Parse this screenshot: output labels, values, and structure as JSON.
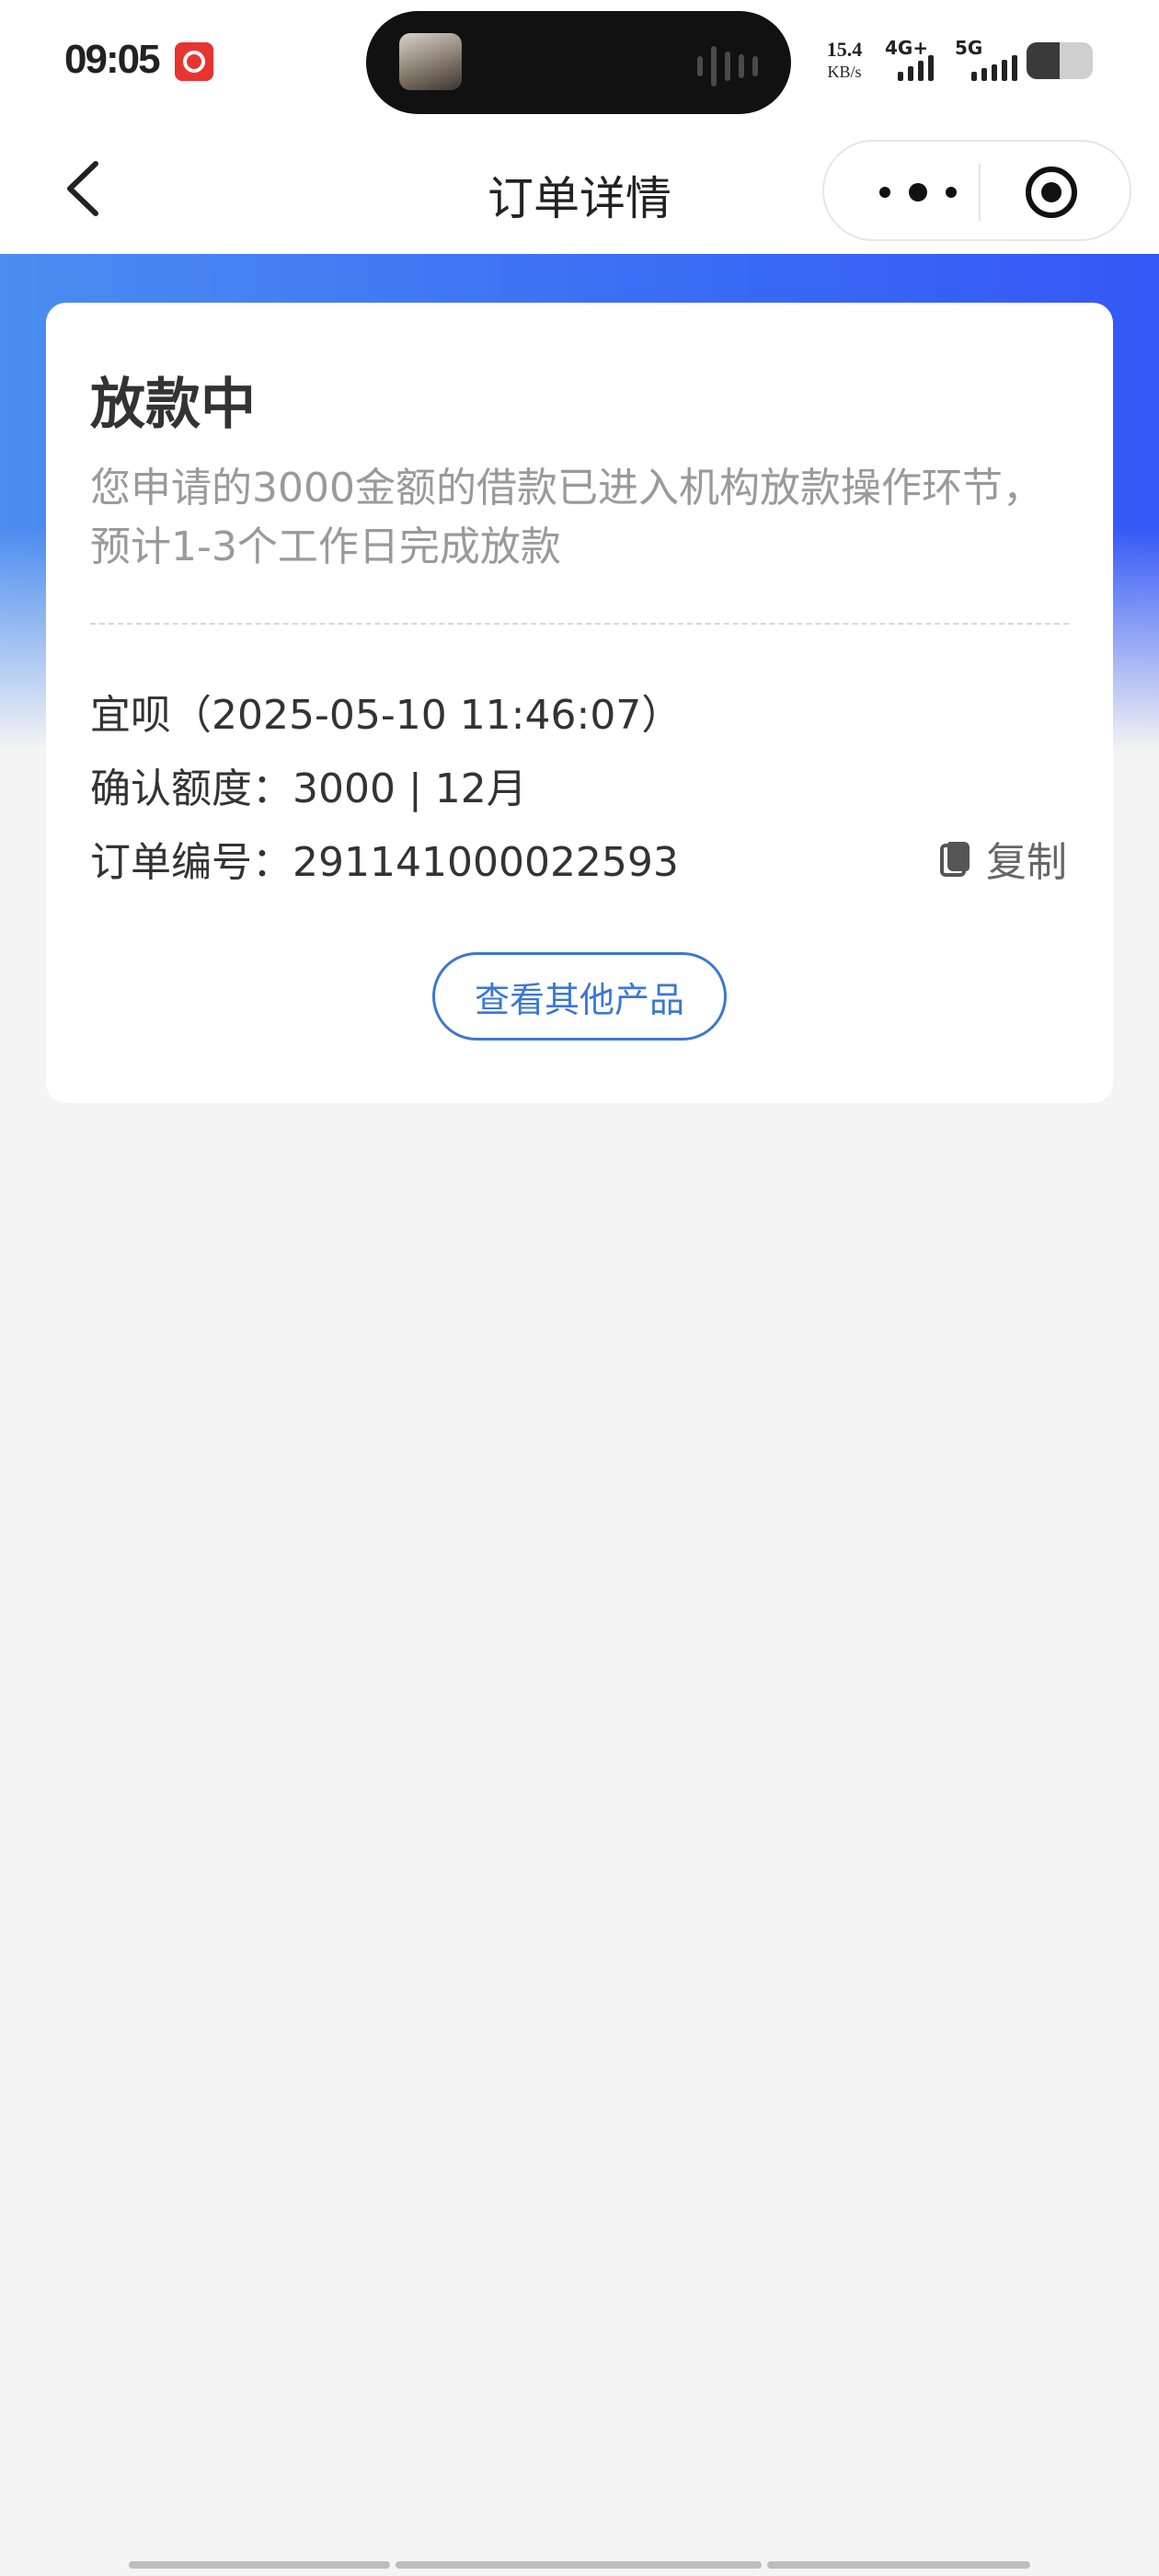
{
  "status_bar": {
    "time": "09:05",
    "app_icon": "netease-music-icon",
    "net_speed_value": "15.4",
    "net_speed_unit": "KB/s",
    "signal1_label": "4G+",
    "signal2_label": "5G",
    "battery_level": 0.5
  },
  "nav": {
    "title": "订单详情",
    "back_icon": "chevron-left-icon",
    "more_icon": "more-dots-icon",
    "close_icon": "target-circle-icon"
  },
  "card": {
    "status_title": "放款中",
    "status_desc": "您申请的3000金额的借款已进入机构放款操作环节，预计1-3个工作日完成放款",
    "product_line": "宜呗（2025-05-10 11:46:07）",
    "amount_line": "确认额度：3000 | 12月",
    "order_label": "订单编号：",
    "order_number": "291141000022593",
    "copy_label": "复制",
    "copy_icon": "copy-icon",
    "other_products_button": "查看其他产品"
  },
  "colors": {
    "accent": "#3b77d4",
    "hero_start": "#4b8df0",
    "hero_end": "#3458f6",
    "page_bg": "#f4f4f4"
  }
}
